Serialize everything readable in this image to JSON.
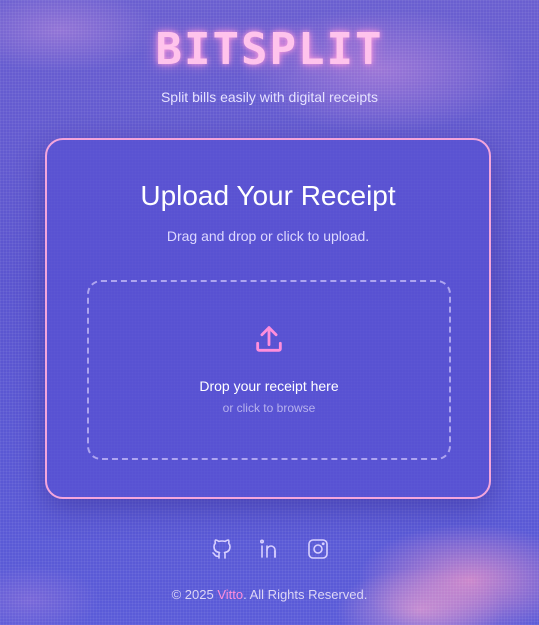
{
  "header": {
    "brand": "BITSPLIT",
    "tagline": "Split bills easily with digital receipts"
  },
  "upload_card": {
    "title": "Upload Your Receipt",
    "subtitle": "Drag and drop or click to upload.",
    "dropzone": {
      "icon": "upload-icon",
      "title": "Drop your receipt here",
      "subtitle": "or click to browse"
    }
  },
  "socials": [
    {
      "name": "github-icon"
    },
    {
      "name": "linkedin-icon"
    },
    {
      "name": "instagram-icon"
    }
  ],
  "footer": {
    "prefix": "© 2025 ",
    "author": "Vitto",
    "suffix": ". All Rights Reserved."
  },
  "colors": {
    "accent_pink": "#ff8edb",
    "card_border": "#f4a6dc",
    "background": "#5a52c8"
  }
}
